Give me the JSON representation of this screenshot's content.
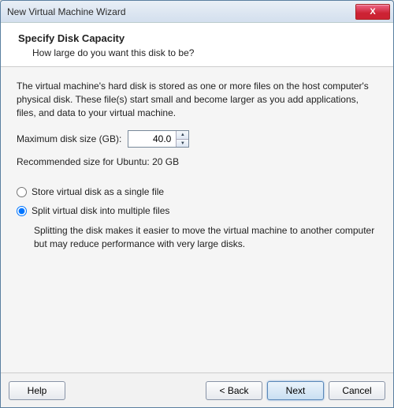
{
  "window": {
    "title": "New Virtual Machine Wizard",
    "close_glyph": "X"
  },
  "header": {
    "title": "Specify Disk Capacity",
    "subtitle": "How large do you want this disk to be?"
  },
  "content": {
    "description": "The virtual machine's hard disk is stored as one or more files on the host computer's physical disk. These file(s) start small and become larger as you add applications, files, and data to your virtual machine.",
    "max_size_label": "Maximum disk size (GB):",
    "max_size_value": "40.0",
    "recommended": "Recommended size for Ubuntu: 20 GB",
    "option_single": "Store virtual disk as a single file",
    "option_split": "Split virtual disk into multiple files",
    "split_description": "Splitting the disk makes it easier to move the virtual machine to another computer but may reduce performance with very large disks.",
    "selected_option": "split"
  },
  "footer": {
    "help": "Help",
    "back": "< Back",
    "next": "Next",
    "cancel": "Cancel"
  }
}
